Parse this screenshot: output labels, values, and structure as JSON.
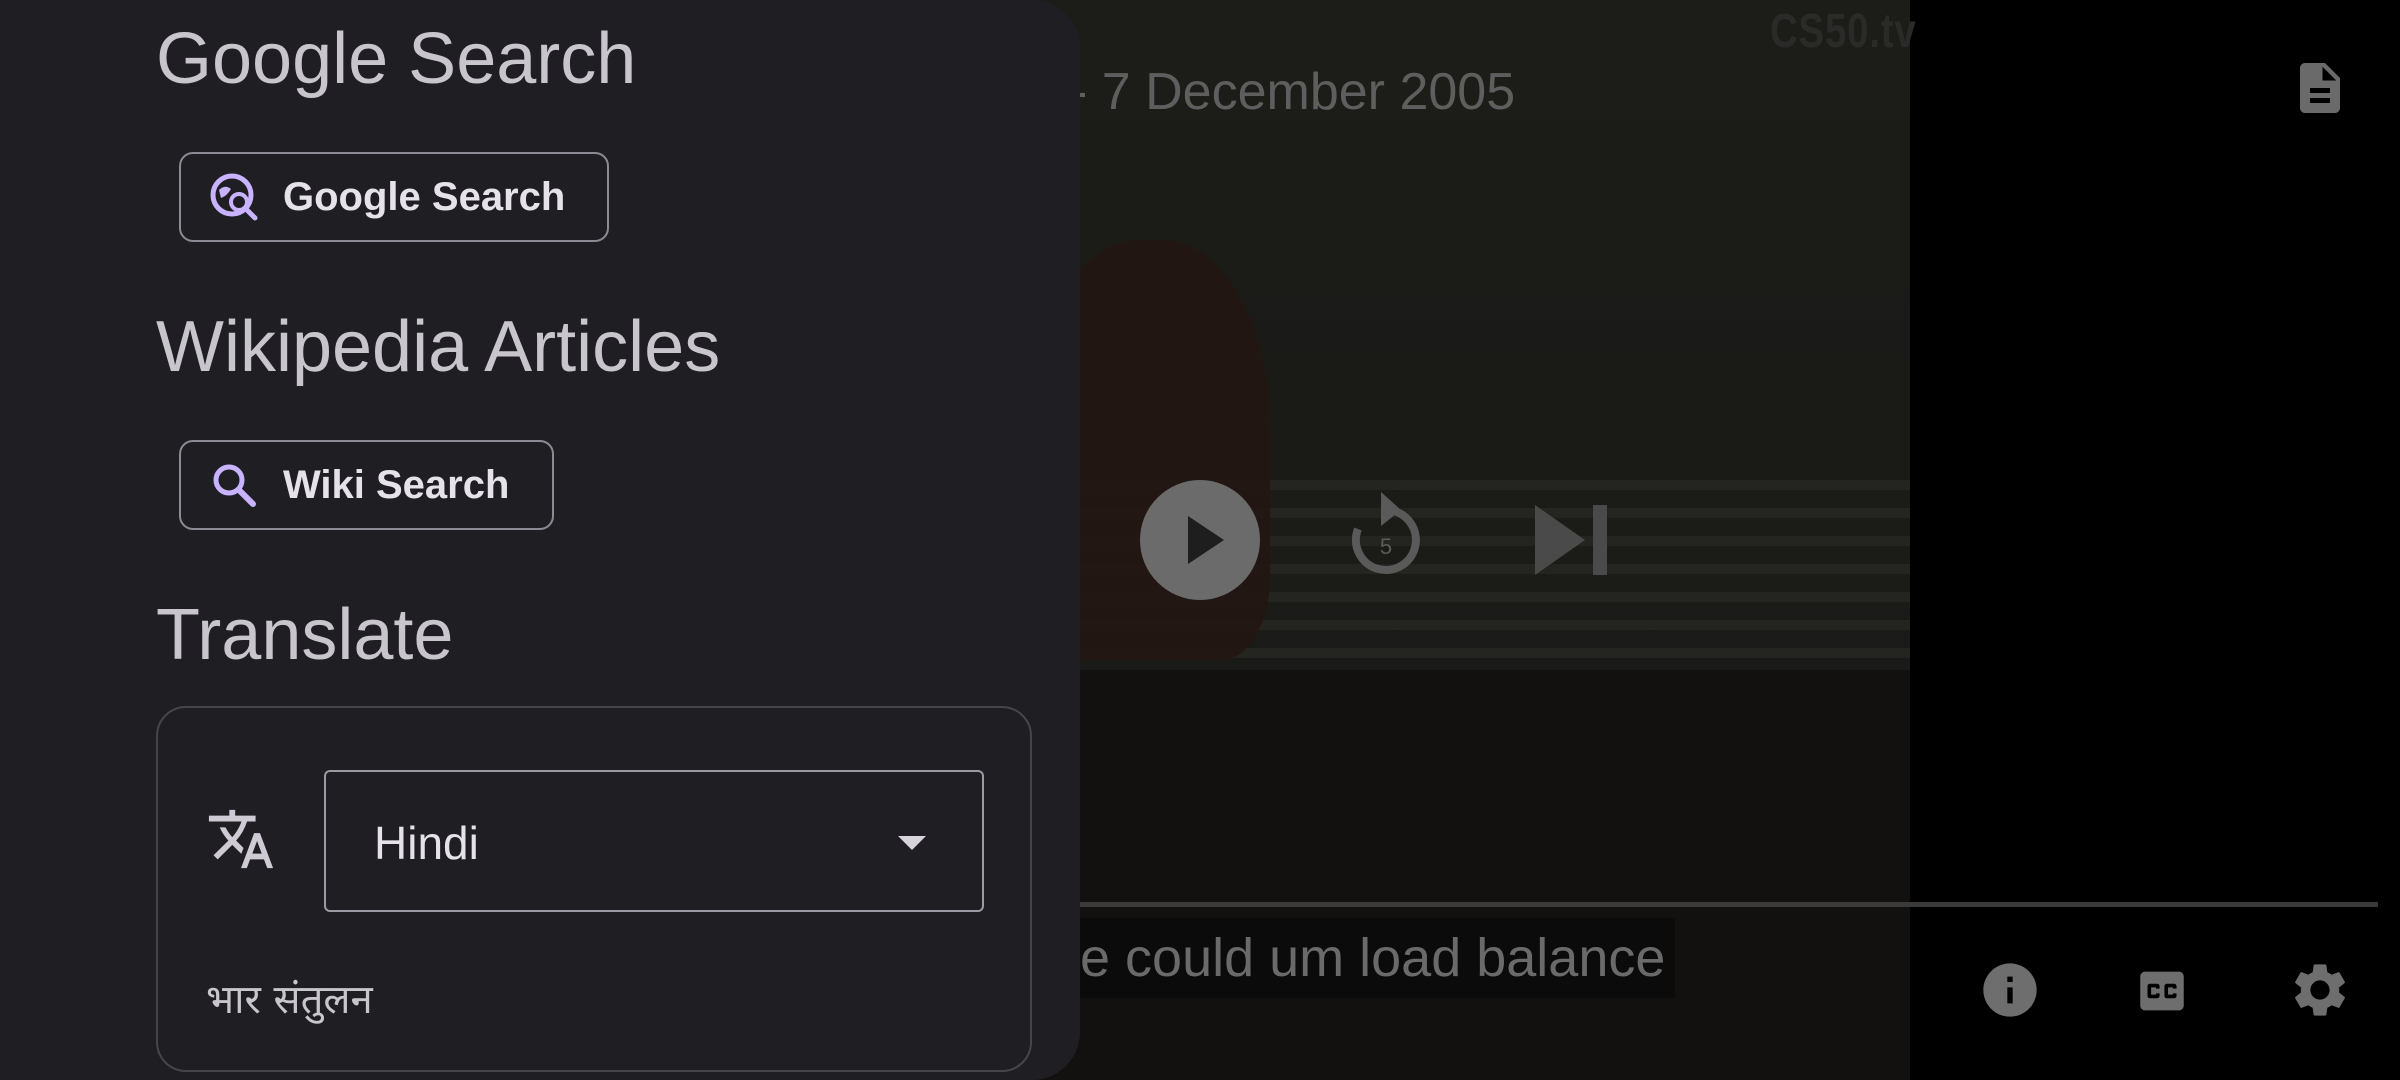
{
  "player": {
    "watermark": "CS50.tv",
    "title_fragment": "- 7 December 2005",
    "caption": "e could um load balance",
    "replay_seconds": "5",
    "icons": {
      "notes": "notes-icon",
      "play": "play-icon",
      "replay": "replay-5-icon",
      "next": "skip-next-icon",
      "info": "info-icon",
      "cc": "closed-captions-icon",
      "settings": "gear-icon"
    }
  },
  "panel": {
    "google": {
      "heading": "Google Search",
      "button_label": "Google Search",
      "icon": "google-search-icon"
    },
    "wikipedia": {
      "heading": "Wikipedia Articles",
      "button_label": "Wiki Search",
      "icon": "search-icon"
    },
    "translate": {
      "heading": "Translate",
      "icon": "translate-icon",
      "selected_language": "Hindi",
      "translated_text": "भार संतुलन"
    }
  },
  "colors": {
    "panel_bg": "#1f1f23",
    "accent": "#c9b3ff",
    "text": "#e6e2ea"
  }
}
